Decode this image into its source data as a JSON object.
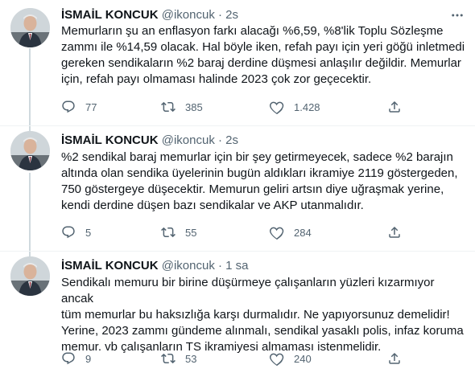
{
  "tweets": [
    {
      "name": "İSMAİL KONCUK",
      "handle": "@ikoncuk",
      "separator": "·",
      "time": "2s",
      "lines": [
        "Memurların şu an enflasyon farkı alacağı %6,59, %8'lik Toplu Sözleşme",
        "zammı ile %14,59 olacak. Hal böyle iken, refah payı için yeri göğü inletmedi",
        "gereken sendikaların %2 baraj derdine düşmesi anlaşılır değildir. Memurlar",
        "için, refah payı olmaması halinde 2023 çok zor geçecektir."
      ],
      "replies": "77",
      "retweets": "385",
      "likes": "1.428"
    },
    {
      "name": "İSMAİL KONCUK",
      "handle": "@ikoncuk",
      "separator": "·",
      "time": "2s",
      "lines": [
        "%2 sendikal baraj memurlar için bir şey getirmeyecek, sadece %2 barajın",
        "altında olan sendika üyelerinin bugün aldıkları ikramiye 2119 göstergeden,",
        "750 göstergeye düşecektir. Memurun geliri artsın diye uğraşmak yerine,",
        "kendi derdine düşen bazı sendikalar ve AKP utanmalıdır."
      ],
      "replies": "5",
      "retweets": "55",
      "likes": "284"
    },
    {
      "name": "İSMAİL KONCUK",
      "handle": "@ikoncuk",
      "separator": "·",
      "time": "1 sa",
      "lines": [
        "Sendikalı memuru bir birine düşürmeye çalışanların yüzleri kızarmıyor ancak",
        "tüm memurlar bu haksızlığa karşı durmalıdır. Ne yapıyorsunuz demelidir!",
        "Yerine, 2023 zammı gündeme alınmalı, sendikal yasaklı polis, infaz koruma",
        "memur. vb çalışanların TS ikramiyesi almaması istenmelidir."
      ],
      "replies": "9",
      "retweets": "53",
      "likes": "240"
    }
  ]
}
